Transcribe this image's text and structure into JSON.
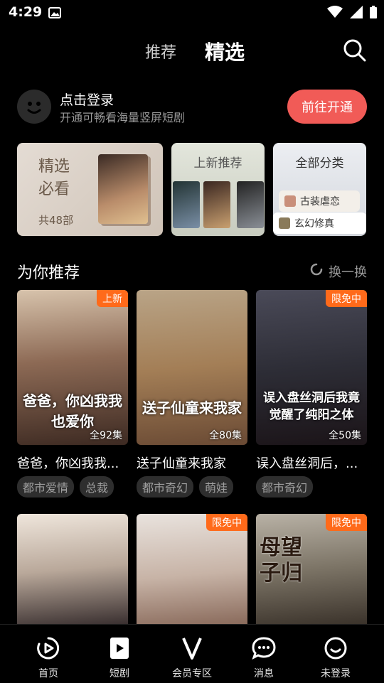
{
  "status": {
    "time": "4:29"
  },
  "topnav": {
    "tab_recommend": "推荐",
    "tab_selected": "精选"
  },
  "login": {
    "title": "点击登录",
    "subtitle": "开通可畅看海量竖屏短剧",
    "button": "前往开通"
  },
  "cards": {
    "featured": {
      "line1": "精选",
      "line2": "必看",
      "count": "共48部"
    },
    "new": {
      "title": "上新推荐"
    },
    "all": {
      "title": "全部分类",
      "pill1": "古装虐恋",
      "pill2": "玄幻修真"
    }
  },
  "section": {
    "title": "为你推荐",
    "refresh": "换一换"
  },
  "items": [
    {
      "badge": "上新",
      "poster_text": "爸爸，你凶我我也爱你",
      "eps": "全92集",
      "title": "爸爸，你凶我我...",
      "tags": [
        "都市爱情",
        "总裁"
      ]
    },
    {
      "badge": "",
      "poster_text": "送子仙童来我家",
      "eps": "全80集",
      "title": "送子仙童来我家",
      "tags": [
        "都市奇幻",
        "萌娃"
      ]
    },
    {
      "badge": "限免中",
      "poster_text": "误入盘丝洞后我竟觉醒了纯阳之体",
      "eps": "全50集",
      "title": "误入盘丝洞后，...",
      "tags": [
        "都市奇幻"
      ]
    },
    {
      "badge": "",
      "poster_text": "",
      "eps": "",
      "title": "",
      "tags": []
    },
    {
      "badge": "限免中",
      "poster_text": "",
      "eps": "",
      "title": "",
      "tags": []
    },
    {
      "badge": "限免中",
      "poster_text": "母望子归",
      "eps": "",
      "title": "",
      "tags": []
    }
  ],
  "nav": {
    "home": "首页",
    "short": "短剧",
    "vip": "会员专区",
    "msg": "消息",
    "me": "未登录"
  },
  "colors": {
    "accent": "#f15b57",
    "badge": "#ff6a1a"
  }
}
